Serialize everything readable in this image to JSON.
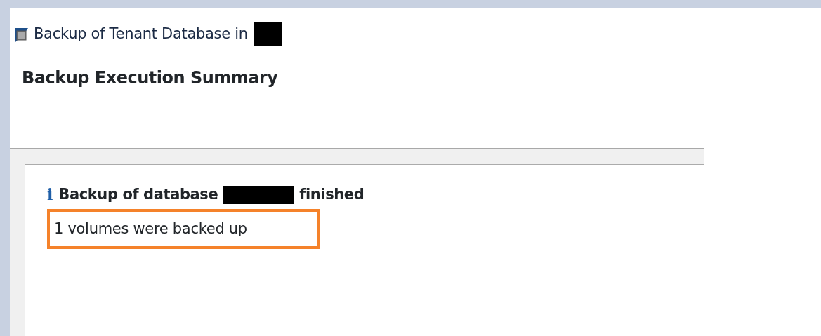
{
  "window": {
    "title": "Backup of Tenant Database in",
    "title_redacted": true
  },
  "page_heading": "Backup Execution Summary",
  "message": {
    "icon_glyph": "i",
    "title_before": "Backup of database",
    "title_redacted": true,
    "title_after": "finished",
    "detail": "1 volumes were backed up",
    "highlighted": true
  }
}
